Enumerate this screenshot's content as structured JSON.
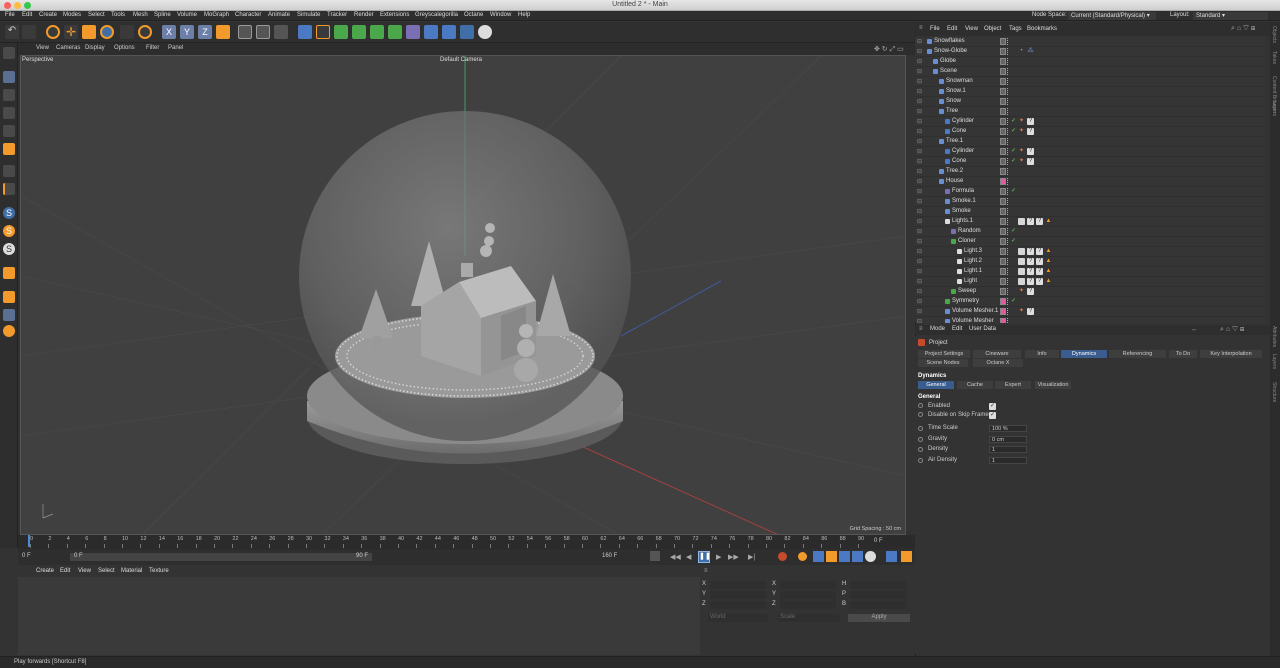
{
  "window": {
    "title": "Untitled 2 * - Main"
  },
  "menu": [
    "File",
    "Edit",
    "Create",
    "Modes",
    "Select",
    "Tools",
    "Mesh",
    "Spline",
    "Volume",
    "MoGraph",
    "Character",
    "Animate",
    "Simulate",
    "Tracker",
    "Render",
    "Extensions",
    "Greyscalegorilla",
    "Octane",
    "Window",
    "Help"
  ],
  "nodespace": {
    "label": "Node Space:",
    "value": "Current (Standard/Physical)"
  },
  "layout": {
    "label": "Layout:",
    "value": "Standard"
  },
  "toolbar": {
    "x": "X",
    "y": "Y",
    "z": "Z"
  },
  "viewport": {
    "menu": [
      "View",
      "Cameras",
      "Display",
      "Options",
      "Filter",
      "Panel"
    ],
    "name": "Perspective",
    "camera": "Default Camera",
    "grid": "Grid Spacing : 50 cm"
  },
  "timeline": {
    "ticks": [
      "0",
      "2",
      "4",
      "6",
      "8",
      "10",
      "12",
      "14",
      "16",
      "18",
      "20",
      "22",
      "24",
      "26",
      "28",
      "30",
      "32",
      "34",
      "36",
      "38",
      "40",
      "42",
      "44",
      "46",
      "48",
      "50",
      "52",
      "54",
      "56",
      "58",
      "60",
      "62",
      "64",
      "66",
      "68",
      "70",
      "72",
      "74",
      "76",
      "78",
      "80",
      "82",
      "84",
      "86",
      "88",
      "90"
    ],
    "current": "0 F"
  },
  "transport": {
    "start": "0 F",
    "range_start": "0 F",
    "range_end": "90 F",
    "end": "160 F"
  },
  "material_menu": [
    "Create",
    "Edit",
    "View",
    "Select",
    "Material",
    "Texture"
  ],
  "objects_menu": [
    "File",
    "Edit",
    "View",
    "Object",
    "Tags",
    "Bookmarks"
  ],
  "objects": [
    {
      "name": "Snowflakes",
      "indent": 0
    },
    {
      "name": "Snow-Globe",
      "indent": 0
    },
    {
      "name": "Globe",
      "indent": 1
    },
    {
      "name": "Scene",
      "indent": 1
    },
    {
      "name": "Snowman",
      "indent": 2
    },
    {
      "name": "Snow.1",
      "indent": 2
    },
    {
      "name": "Snow",
      "indent": 2
    },
    {
      "name": "Tree",
      "indent": 2
    },
    {
      "name": "Cylinder",
      "indent": 3
    },
    {
      "name": "Cone",
      "indent": 3
    },
    {
      "name": "Tree.1",
      "indent": 2
    },
    {
      "name": "Cylinder",
      "indent": 3
    },
    {
      "name": "Cone",
      "indent": 3
    },
    {
      "name": "Tree.2",
      "indent": 2
    },
    {
      "name": "House",
      "indent": 2
    },
    {
      "name": "Formula",
      "indent": 3
    },
    {
      "name": "Smoke.1",
      "indent": 3
    },
    {
      "name": "Smoke",
      "indent": 3
    },
    {
      "name": "Lights.1",
      "indent": 3
    },
    {
      "name": "Random",
      "indent": 4
    },
    {
      "name": "Cloner",
      "indent": 4
    },
    {
      "name": "Light.3",
      "indent": 5
    },
    {
      "name": "Light.2",
      "indent": 5
    },
    {
      "name": "Light.1",
      "indent": 5
    },
    {
      "name": "Light",
      "indent": 5
    },
    {
      "name": "Sweep",
      "indent": 4
    },
    {
      "name": "Symmetry",
      "indent": 3
    },
    {
      "name": "Volume Mesher.1",
      "indent": 3
    },
    {
      "name": "Volume Mesher",
      "indent": 3
    }
  ],
  "attr_menu": [
    "Mode",
    "Edit",
    "User Data"
  ],
  "attr": {
    "project": "Project",
    "tabs": [
      "Project Settings",
      "Cineware",
      "Info",
      "Dynamics",
      "Referencing",
      "To Do",
      "Key Interpolation"
    ],
    "tabs2": [
      "Scene Nodes",
      "Octane X"
    ],
    "section": "Dynamics",
    "subtabs": [
      "General",
      "Cache",
      "Expert",
      "Visualization"
    ],
    "group": "General",
    "enabled": "Enabled",
    "skip": "Disable on Skip Frame",
    "params": [
      {
        "label": "Time Scale",
        "value": "100 %"
      },
      {
        "label": "Gravity",
        "value": "0 cm"
      },
      {
        "label": "Density",
        "value": "1"
      },
      {
        "label": "Air Density",
        "value": "1"
      }
    ]
  },
  "coords": {
    "rows": [
      [
        "X",
        "X",
        "H"
      ],
      [
        "Y",
        "Y",
        "P"
      ],
      [
        "Z",
        "Z",
        "B"
      ]
    ],
    "world": "World",
    "scale": "Scale",
    "apply": "Apply"
  },
  "status": "Play forwards [Shortcut F8]",
  "sidetabs": [
    "Objects",
    "Takes",
    "Content Browser",
    "Layers"
  ],
  "sidetabs2": [
    "Attributes",
    "Layers",
    "Structure"
  ]
}
